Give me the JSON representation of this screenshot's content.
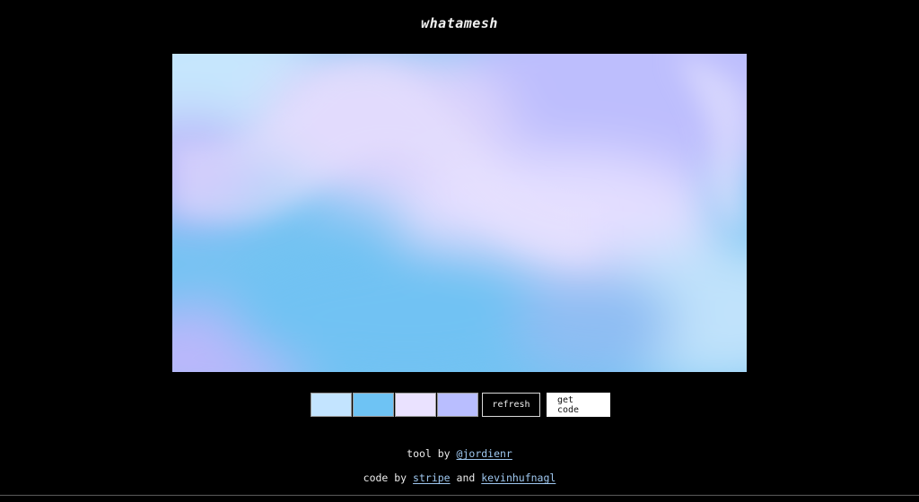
{
  "header": {
    "title": "whatamesh"
  },
  "gradient": {
    "colors": [
      "#c3e4ff",
      "#6ec3f4",
      "#eae2ff",
      "#b9beff"
    ]
  },
  "controls": {
    "swatches": [
      {
        "color": "#c3e4ff"
      },
      {
        "color": "#6ec3f4"
      },
      {
        "color": "#eae2ff"
      },
      {
        "color": "#b9beff"
      }
    ],
    "refresh_label": "refresh",
    "get_code_label": "get code"
  },
  "credits": {
    "tool_prefix": "tool by",
    "tool_author": "@jordienr",
    "code_prefix": "code by",
    "code_author_1": "stripe",
    "code_joiner": "and",
    "code_author_2": "kevinhufnagl"
  }
}
